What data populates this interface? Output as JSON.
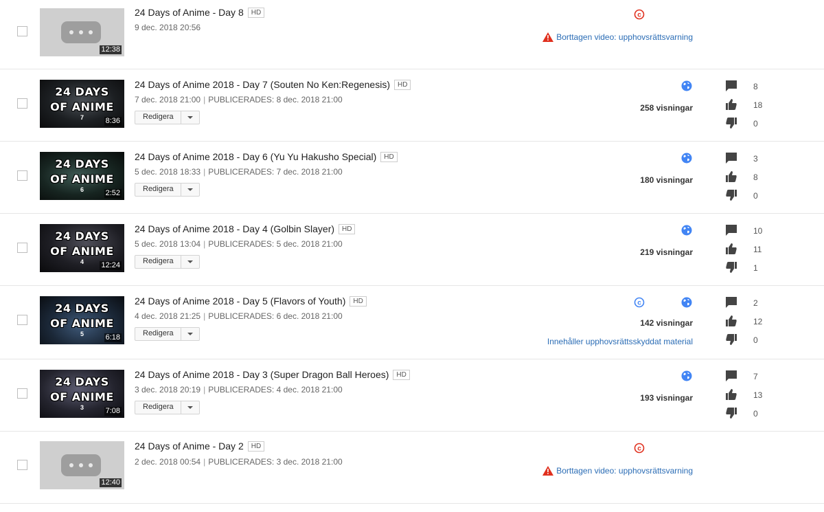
{
  "colors": {
    "link": "#2a6cb5",
    "warning_red": "#e0301e",
    "globe_blue": "#4285f4",
    "icon_grey": "#444444"
  },
  "edit_button_label": "Redigera",
  "rows": [
    {
      "title": "24 Days of Anime - Day 8",
      "hd": "HD",
      "date": "9 dec. 2018 20:56",
      "published": "",
      "duration": "12:38",
      "thumbnail": "placeholder",
      "warning": "Borttagen video: upphovsrättsvarning"
    },
    {
      "title": "24 Days of Anime 2018 - Day 7 (Souten No Ken:Regenesis)",
      "hd": "HD",
      "date": "7 dec. 2018 21:00",
      "published": "PUBLICERADES: 8 dec. 2018 21:00",
      "duration": "8:36",
      "thumbnail": {
        "line1": "24 DAYS",
        "line2": "OF ANIME",
        "num": "7"
      },
      "views": "258 visningar",
      "comments": "8",
      "likes": "18",
      "dislikes": "0"
    },
    {
      "title": "24 Days of Anime 2018 - Day 6 (Yu Yu Hakusho Special)",
      "hd": "HD",
      "date": "5 dec. 2018 18:33",
      "published": "PUBLICERADES: 7 dec. 2018 21:00",
      "duration": "2:52",
      "thumbnail": {
        "line1": "24 DAYS",
        "line2": "OF ANIME",
        "num": "6"
      },
      "views": "180 visningar",
      "comments": "3",
      "likes": "8",
      "dislikes": "0"
    },
    {
      "title": "24 Days of Anime 2018 - Day 4 (Golbin Slayer)",
      "hd": "HD",
      "date": "5 dec. 2018 13:04",
      "published": "PUBLICERADES: 5 dec. 2018 21:00",
      "duration": "12:24",
      "thumbnail": {
        "line1": "24 DAYS",
        "line2": "OF ANIME",
        "num": "4"
      },
      "views": "219 visningar",
      "comments": "10",
      "likes": "11",
      "dislikes": "1"
    },
    {
      "title": "24 Days of Anime 2018 - Day 5 (Flavors of Youth)",
      "hd": "HD",
      "date": "4 dec. 2018 21:25",
      "published": "PUBLICERADES: 6 dec. 2018 21:00",
      "duration": "6:18",
      "thumbnail": {
        "line1": "24 DAYS",
        "line2": "OF ANIME",
        "num": "5"
      },
      "views": "142 visningar",
      "notice": "Innehåller upphovsrättsskyddat material",
      "comments": "2",
      "likes": "12",
      "dislikes": "0"
    },
    {
      "title": "24 Days of Anime 2018 - Day 3 (Super Dragon Ball Heroes)",
      "hd": "HD",
      "date": "3 dec. 2018 20:19",
      "published": "PUBLICERADES: 4 dec. 2018 21:00",
      "duration": "7:08",
      "thumbnail": {
        "line1": "24 DAYS",
        "line2": "OF ANIME",
        "num": "3"
      },
      "views": "193 visningar",
      "comments": "7",
      "likes": "13",
      "dislikes": "0"
    },
    {
      "title": "24 Days of Anime - Day 2",
      "hd": "HD",
      "date": "2 dec. 2018 00:54",
      "published": "PUBLICERADES: 3 dec. 2018 21:00",
      "duration": "12:40",
      "thumbnail": "placeholder",
      "warning": "Borttagen video: upphovsrättsvarning"
    }
  ]
}
